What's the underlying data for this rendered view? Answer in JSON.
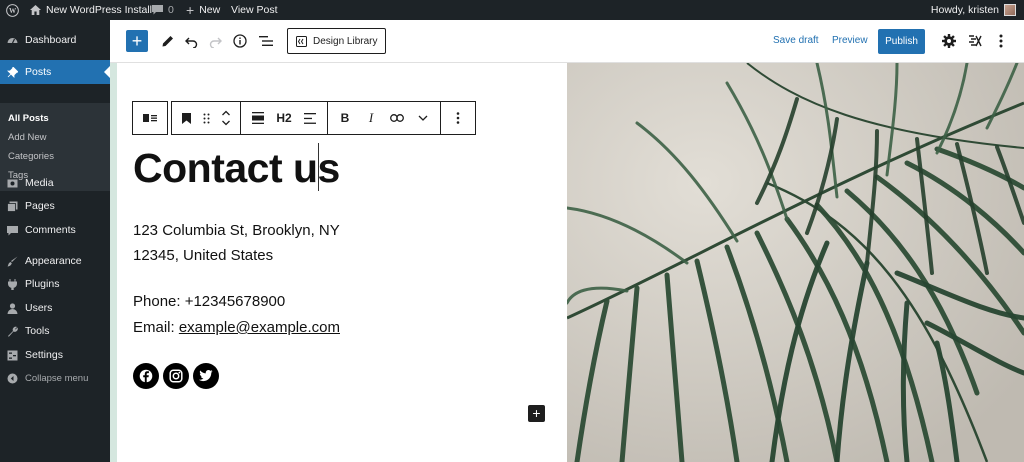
{
  "adminbar": {
    "site_name": "New WordPress Install",
    "comments_count": "0",
    "new_label": "New",
    "view_post_label": "View Post",
    "howdy": "Howdy, kristen"
  },
  "sidebar": {
    "items": [
      {
        "label": "Dashboard",
        "icon": "dashboard-icon"
      },
      {
        "label": "Posts",
        "icon": "pin-icon"
      },
      {
        "label": "Media",
        "icon": "media-icon"
      },
      {
        "label": "Pages",
        "icon": "pages-icon"
      },
      {
        "label": "Comments",
        "icon": "comment-icon"
      },
      {
        "label": "Appearance",
        "icon": "brush-icon"
      },
      {
        "label": "Plugins",
        "icon": "plug-icon"
      },
      {
        "label": "Users",
        "icon": "user-icon"
      },
      {
        "label": "Tools",
        "icon": "wrench-icon"
      },
      {
        "label": "Settings",
        "icon": "settings-icon"
      },
      {
        "label": "Collapse menu",
        "icon": "collapse-icon"
      }
    ],
    "submenu": [
      "All Posts",
      "Add New",
      "Categories",
      "Tags"
    ]
  },
  "editor": {
    "design_library": "Design Library",
    "save_draft": "Save draft",
    "preview": "Preview",
    "publish": "Publish",
    "block_toolbar": {
      "heading_level": "H2"
    }
  },
  "content": {
    "heading": "Contact us",
    "address_line1": "123 Columbia St, Brooklyn, NY",
    "address_line2": "12345, United States",
    "phone": "Phone: +12345678900",
    "email_prefix": "Email: ",
    "email": "example@example.com",
    "social": [
      "facebook-icon",
      "instagram-icon",
      "twitter-icon"
    ]
  },
  "colors": {
    "admin_dark": "#1d2327",
    "wp_blue": "#2271b1",
    "canvas_bg": "#d5e7df"
  }
}
